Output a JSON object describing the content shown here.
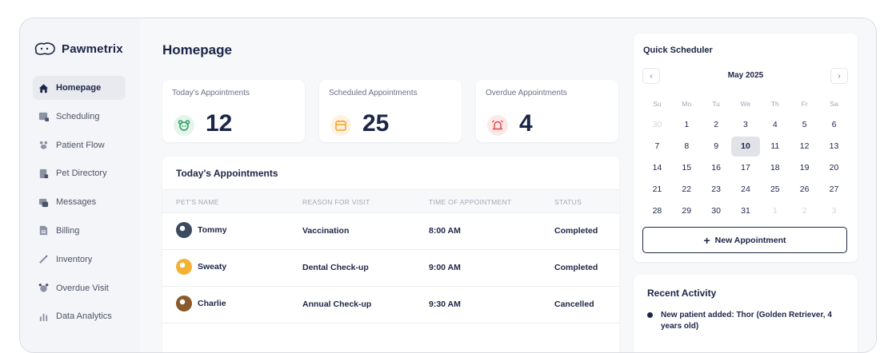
{
  "app": {
    "name": "Pawmetrix"
  },
  "sidebar": {
    "items": [
      {
        "label": "Homepage",
        "icon": "home-icon",
        "active": true
      },
      {
        "label": "Scheduling",
        "icon": "calendar-grid-icon"
      },
      {
        "label": "Patient Flow",
        "icon": "paw-icon"
      },
      {
        "label": "Pet Directory",
        "icon": "directory-icon"
      },
      {
        "label": "Messages",
        "icon": "messages-icon"
      },
      {
        "label": "Billing",
        "icon": "billing-icon"
      },
      {
        "label": "Inventory",
        "icon": "syringe-icon"
      },
      {
        "label": "Overdue Visit",
        "icon": "alarm-clock-icon"
      },
      {
        "label": "Data Analytics",
        "icon": "analytics-icon"
      }
    ]
  },
  "main": {
    "title": "Homepage",
    "stats": [
      {
        "label": "Today's Appointments",
        "value": "12",
        "icon": "pet-face-icon",
        "color": "#2e9d63",
        "bg": "#e5f5ec"
      },
      {
        "label": "Scheduled Appointments",
        "value": "25",
        "icon": "calendar-icon",
        "color": "#f2a12b",
        "bg": "#fff3e0"
      },
      {
        "label": "Overdue Appointments",
        "value": "4",
        "icon": "alarm-bell-icon",
        "color": "#e5484d",
        "bg": "#fde8e8"
      }
    ],
    "appointments": {
      "title": "Today's Appointments",
      "columns": [
        "PET'S NAME",
        "REASON FOR VISIT",
        "TIME OF APPOINTMENT",
        "STATUS"
      ],
      "rows": [
        {
          "pet": "Tommy",
          "reason": "Vaccination",
          "time": "8:00 AM",
          "status": "Completed"
        },
        {
          "pet": "Sweaty",
          "reason": "Dental Check-up",
          "time": "9:00 AM",
          "status": "Completed"
        },
        {
          "pet": "Charlie",
          "reason": "Annual Check-up",
          "time": "9:30 AM",
          "status": "Cancelled"
        }
      ]
    }
  },
  "scheduler": {
    "title": "Quick Scheduler",
    "month": "May 2025",
    "prev": "‹",
    "next": "›",
    "weekdays": [
      "Su",
      "Mo",
      "Tu",
      "We",
      "Th",
      "Fr",
      "Sa"
    ],
    "weeks": [
      [
        "30",
        "1",
        "2",
        "3",
        "4",
        "5",
        "6"
      ],
      [
        "7",
        "8",
        "9",
        "10",
        "11",
        "12",
        "13"
      ],
      [
        "14",
        "15",
        "16",
        "17",
        "18",
        "19",
        "20"
      ],
      [
        "21",
        "22",
        "23",
        "24",
        "25",
        "26",
        "27"
      ],
      [
        "28",
        "29",
        "30",
        "31",
        "1",
        "2",
        "3"
      ]
    ],
    "faded": [
      [
        0,
        0
      ],
      [
        4,
        4
      ],
      [
        4,
        5
      ],
      [
        4,
        6
      ]
    ],
    "selected": [
      1,
      3
    ],
    "new_button": "New Appointment",
    "new_button_icon": "+"
  },
  "recent": {
    "title": "Recent Activity",
    "items": [
      "New patient added: Thor (Golden Retriever, 4 years old)"
    ]
  }
}
